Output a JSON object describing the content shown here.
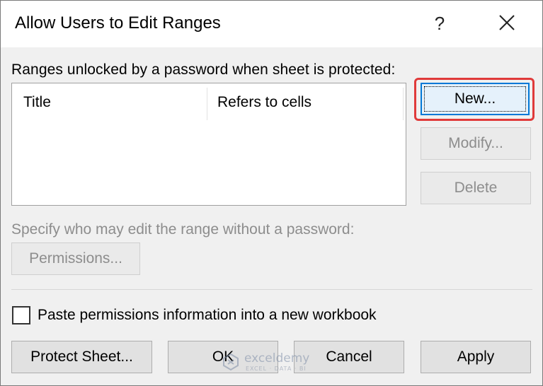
{
  "window": {
    "title": "Allow Users to Edit Ranges",
    "help_label": "?",
    "close_icon": "close-icon"
  },
  "ranges": {
    "label": "Ranges unlocked by a password when sheet is protected:",
    "columns": [
      "Title",
      "Refers to cells"
    ],
    "rows": []
  },
  "side_buttons": {
    "new_label": "New...",
    "modify_label": "Modify...",
    "delete_label": "Delete"
  },
  "permissions": {
    "label": "Specify who may edit the range without a password:",
    "button_label": "Permissions..."
  },
  "paste_option": {
    "label": "Paste permissions information into a new workbook",
    "checked": false
  },
  "footer": {
    "protect_label": "Protect Sheet...",
    "ok_label": "OK",
    "cancel_label": "Cancel",
    "apply_label": "Apply"
  },
  "annotation": {
    "highlight_color": "#e03a3a",
    "focus_color": "#0078d7"
  },
  "watermark": {
    "name": "exceldemy",
    "tagline": "EXCEL · DATA · BI"
  }
}
